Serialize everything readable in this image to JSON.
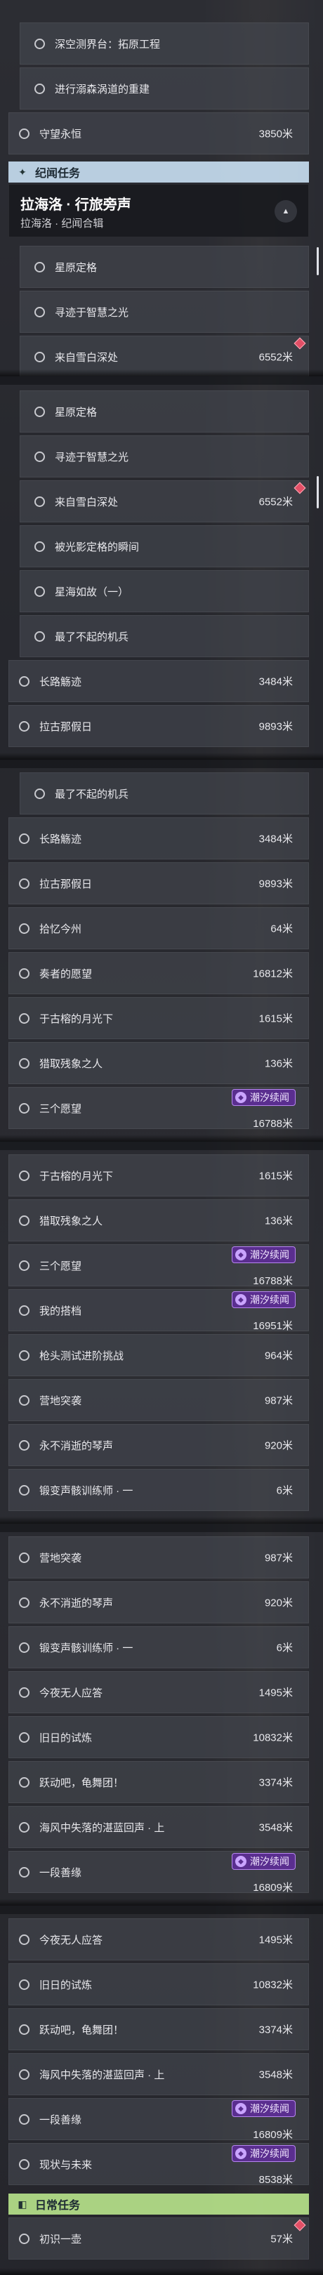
{
  "units": "米",
  "section_ji": {
    "title": "纪闻任务",
    "icon": "✦"
  },
  "section_daily": {
    "title": "日常任务",
    "icon": "◧"
  },
  "group": {
    "title": "拉海洛 · 行旅旁声",
    "subtitle": "拉海洛 · 纪闻合辑"
  },
  "tag_label": "潮汐续闻",
  "panel1": [
    {
      "label": "深空测界台：拓原工程"
    },
    {
      "label": "进行溺森涡道的重建"
    },
    {
      "label": "守望永恒",
      "dist": "3850米"
    }
  ],
  "panel1_sub": [
    {
      "label": "星原定格"
    },
    {
      "label": "寻迹于智慧之光"
    },
    {
      "label": "来自雪白深处",
      "dist": "6552米"
    }
  ],
  "panel2": [
    {
      "label": "星原定格"
    },
    {
      "label": "寻迹于智慧之光"
    },
    {
      "label": "来自雪白深处",
      "dist": "6552米"
    },
    {
      "label": "被光影定格的瞬间"
    },
    {
      "label": "星海如故（一）"
    },
    {
      "label": "最了不起的机兵"
    },
    {
      "label": "长路觞迹",
      "dist": "3484米"
    },
    {
      "label": "拉古那假日",
      "dist": "9893米"
    }
  ],
  "panel3": [
    {
      "label": "最了不起的机兵"
    },
    {
      "label": "长路觞迹",
      "dist": "3484米"
    },
    {
      "label": "拉古那假日",
      "dist": "9893米"
    },
    {
      "label": "拾忆今州",
      "dist": "64米"
    },
    {
      "label": "奏者的愿望",
      "dist": "16812米"
    },
    {
      "label": "于古榕的月光下",
      "dist": "1615米"
    },
    {
      "label": "猎取残象之人",
      "dist": "136米"
    },
    {
      "label": "三个愿望",
      "dist": "16788米"
    }
  ],
  "panel4": [
    {
      "label": "于古榕的月光下",
      "dist": "1615米"
    },
    {
      "label": "猎取残象之人",
      "dist": "136米"
    },
    {
      "label": "三个愿望",
      "dist": "16788米"
    },
    {
      "label": "我的搭档",
      "dist": "16951米"
    },
    {
      "label": "枪头测试进阶挑战",
      "dist": "964米"
    },
    {
      "label": "营地突袭",
      "dist": "987米"
    },
    {
      "label": "永不消逝的琴声",
      "dist": "920米"
    },
    {
      "label": "锻变声骸训练师 · 一",
      "dist": "6米"
    }
  ],
  "panel5": [
    {
      "label": "营地突袭",
      "dist": "987米"
    },
    {
      "label": "永不消逝的琴声",
      "dist": "920米"
    },
    {
      "label": "锻变声骸训练师 · 一",
      "dist": "6米"
    },
    {
      "label": "今夜无人应答",
      "dist": "1495米"
    },
    {
      "label": "旧日的试炼",
      "dist": "10832米"
    },
    {
      "label": "跃动吧，龟舞团！",
      "dist": "3374米"
    },
    {
      "label": "海风中失落的湛蓝回声 · 上",
      "dist": "3548米"
    },
    {
      "label": "一段善缘",
      "dist": "16809米"
    }
  ],
  "panel6": [
    {
      "label": "今夜无人应答",
      "dist": "1495米"
    },
    {
      "label": "旧日的试炼",
      "dist": "10832米"
    },
    {
      "label": "跃动吧，龟舞团！",
      "dist": "3374米"
    },
    {
      "label": "海风中失落的湛蓝回声 · 上",
      "dist": "3548米"
    },
    {
      "label": "一段善缘",
      "dist": "16809米"
    },
    {
      "label": "现状与未来",
      "dist": "8538米"
    }
  ],
  "daily": [
    {
      "label": "初识一壶",
      "dist": "57米"
    }
  ]
}
